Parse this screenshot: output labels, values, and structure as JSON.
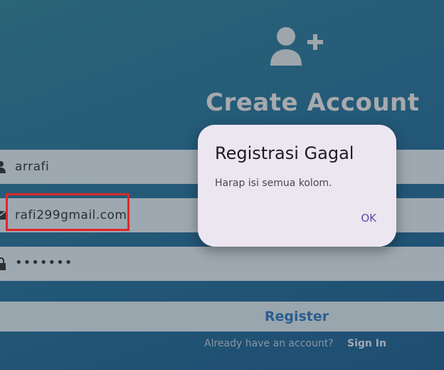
{
  "header": {
    "title": "Create Account",
    "icon": "person-add-icon"
  },
  "form": {
    "name_value": "arrafi",
    "email_value": "rafi299gmail.com",
    "password_value": "•••••••",
    "register_label": "Register",
    "already_text": "Already have an account?",
    "signin_label": "Sign In"
  },
  "dialog": {
    "title": "Registrasi Gagal",
    "message": "Harap isi semua kolom.",
    "ok_label": "OK"
  },
  "colors": {
    "accent": "#2a5d8f",
    "highlight": "#e0262a",
    "dialog_bg": "#ece6f1",
    "dialog_button": "#5a4fa5"
  }
}
